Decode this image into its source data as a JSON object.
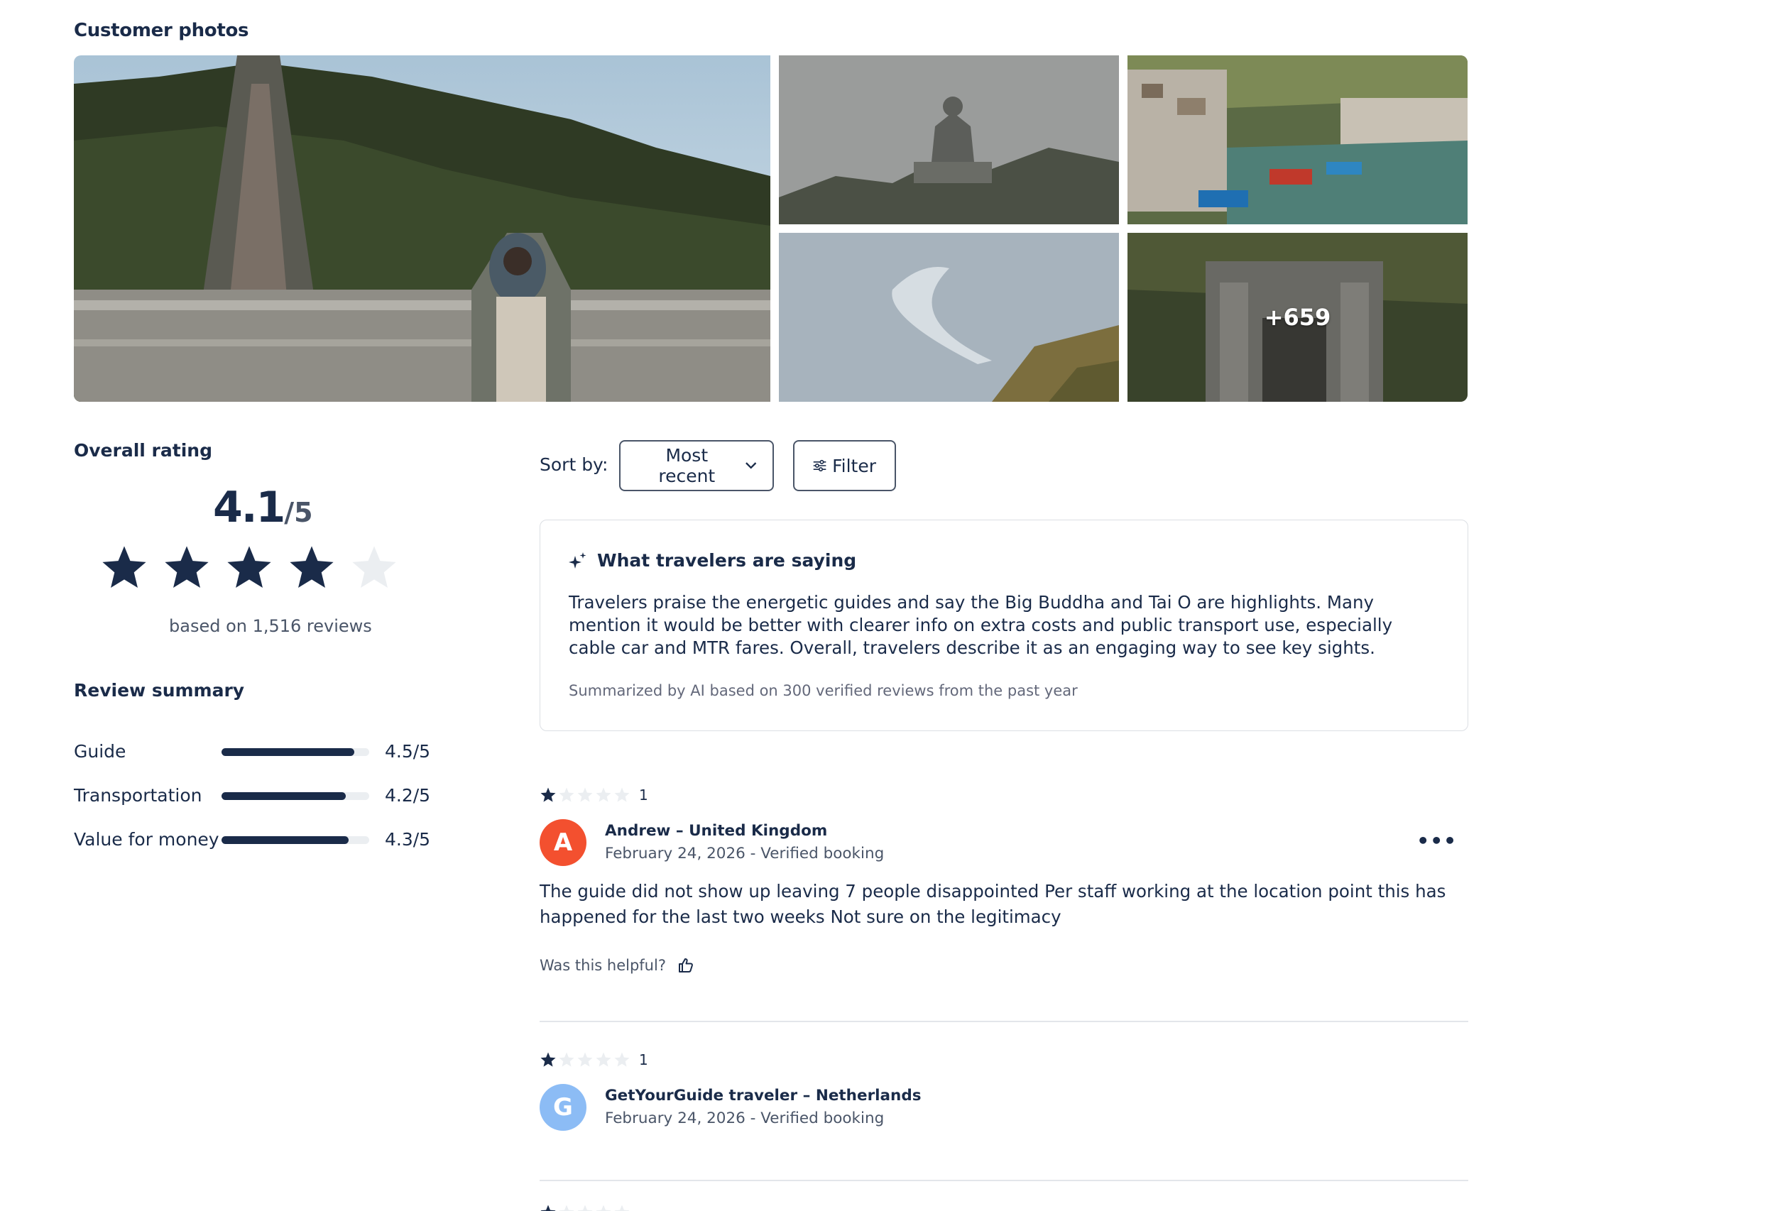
{
  "photos": {
    "title": "Customer photos",
    "more_count": "+659",
    "items": [
      {
        "icon": "staircase-photo"
      },
      {
        "icon": "buddha-photo"
      },
      {
        "icon": "fishing-village-photo"
      },
      {
        "icon": "bridge-photo"
      },
      {
        "icon": "gate-photo"
      }
    ]
  },
  "overall": {
    "title": "Overall rating",
    "score": "4.1",
    "out_of": "/5",
    "rating_value": 4.1,
    "based_on": "based on 1,516 reviews"
  },
  "summary": {
    "title": "Review summary",
    "rows": [
      {
        "label": "Guide",
        "value": "4.5/5",
        "score": 4.5
      },
      {
        "label": "Transportation",
        "value": "4.2/5",
        "score": 4.2
      },
      {
        "label": "Value for money",
        "value": "4.3/5",
        "score": 4.3
      }
    ]
  },
  "toolbar": {
    "sort_label": "Sort by:",
    "sort_value": "Most recent",
    "filter_label": "Filter"
  },
  "ai_summary": {
    "title": "What travelers are saying",
    "body": "Travelers praise the energetic guides and say the Big Buddha and Tai O are highlights. Many mention it would be better with clearer info on extra costs and public transport use, especially cable car and MTR fares. Overall, travelers describe it as an engaging way to see key sights.",
    "footer": "Summarized by AI based on 300 verified reviews from the past year"
  },
  "reviews": [
    {
      "rating": "1",
      "stars": 1,
      "initial": "A",
      "avatar_color": "#f3502f",
      "name": "Andrew – United Kingdom",
      "meta": "February 24, 2026 - Verified booking",
      "text": "The guide did not show up leaving 7 people disappointed Per staff working at the location point this has happened for the last two weeks Not sure on the legitimacy",
      "helpful_label": "Was this helpful?"
    },
    {
      "rating": "1",
      "stars": 1,
      "initial": "G",
      "avatar_color": "#8cbcf5",
      "name": "GetYourGuide traveler – Netherlands",
      "meta": "February 24, 2026 - Verified booking"
    }
  ],
  "colors": {
    "primary": "#1a2b49",
    "star_empty": "#ebeef1",
    "border": "#dcdfe4"
  }
}
